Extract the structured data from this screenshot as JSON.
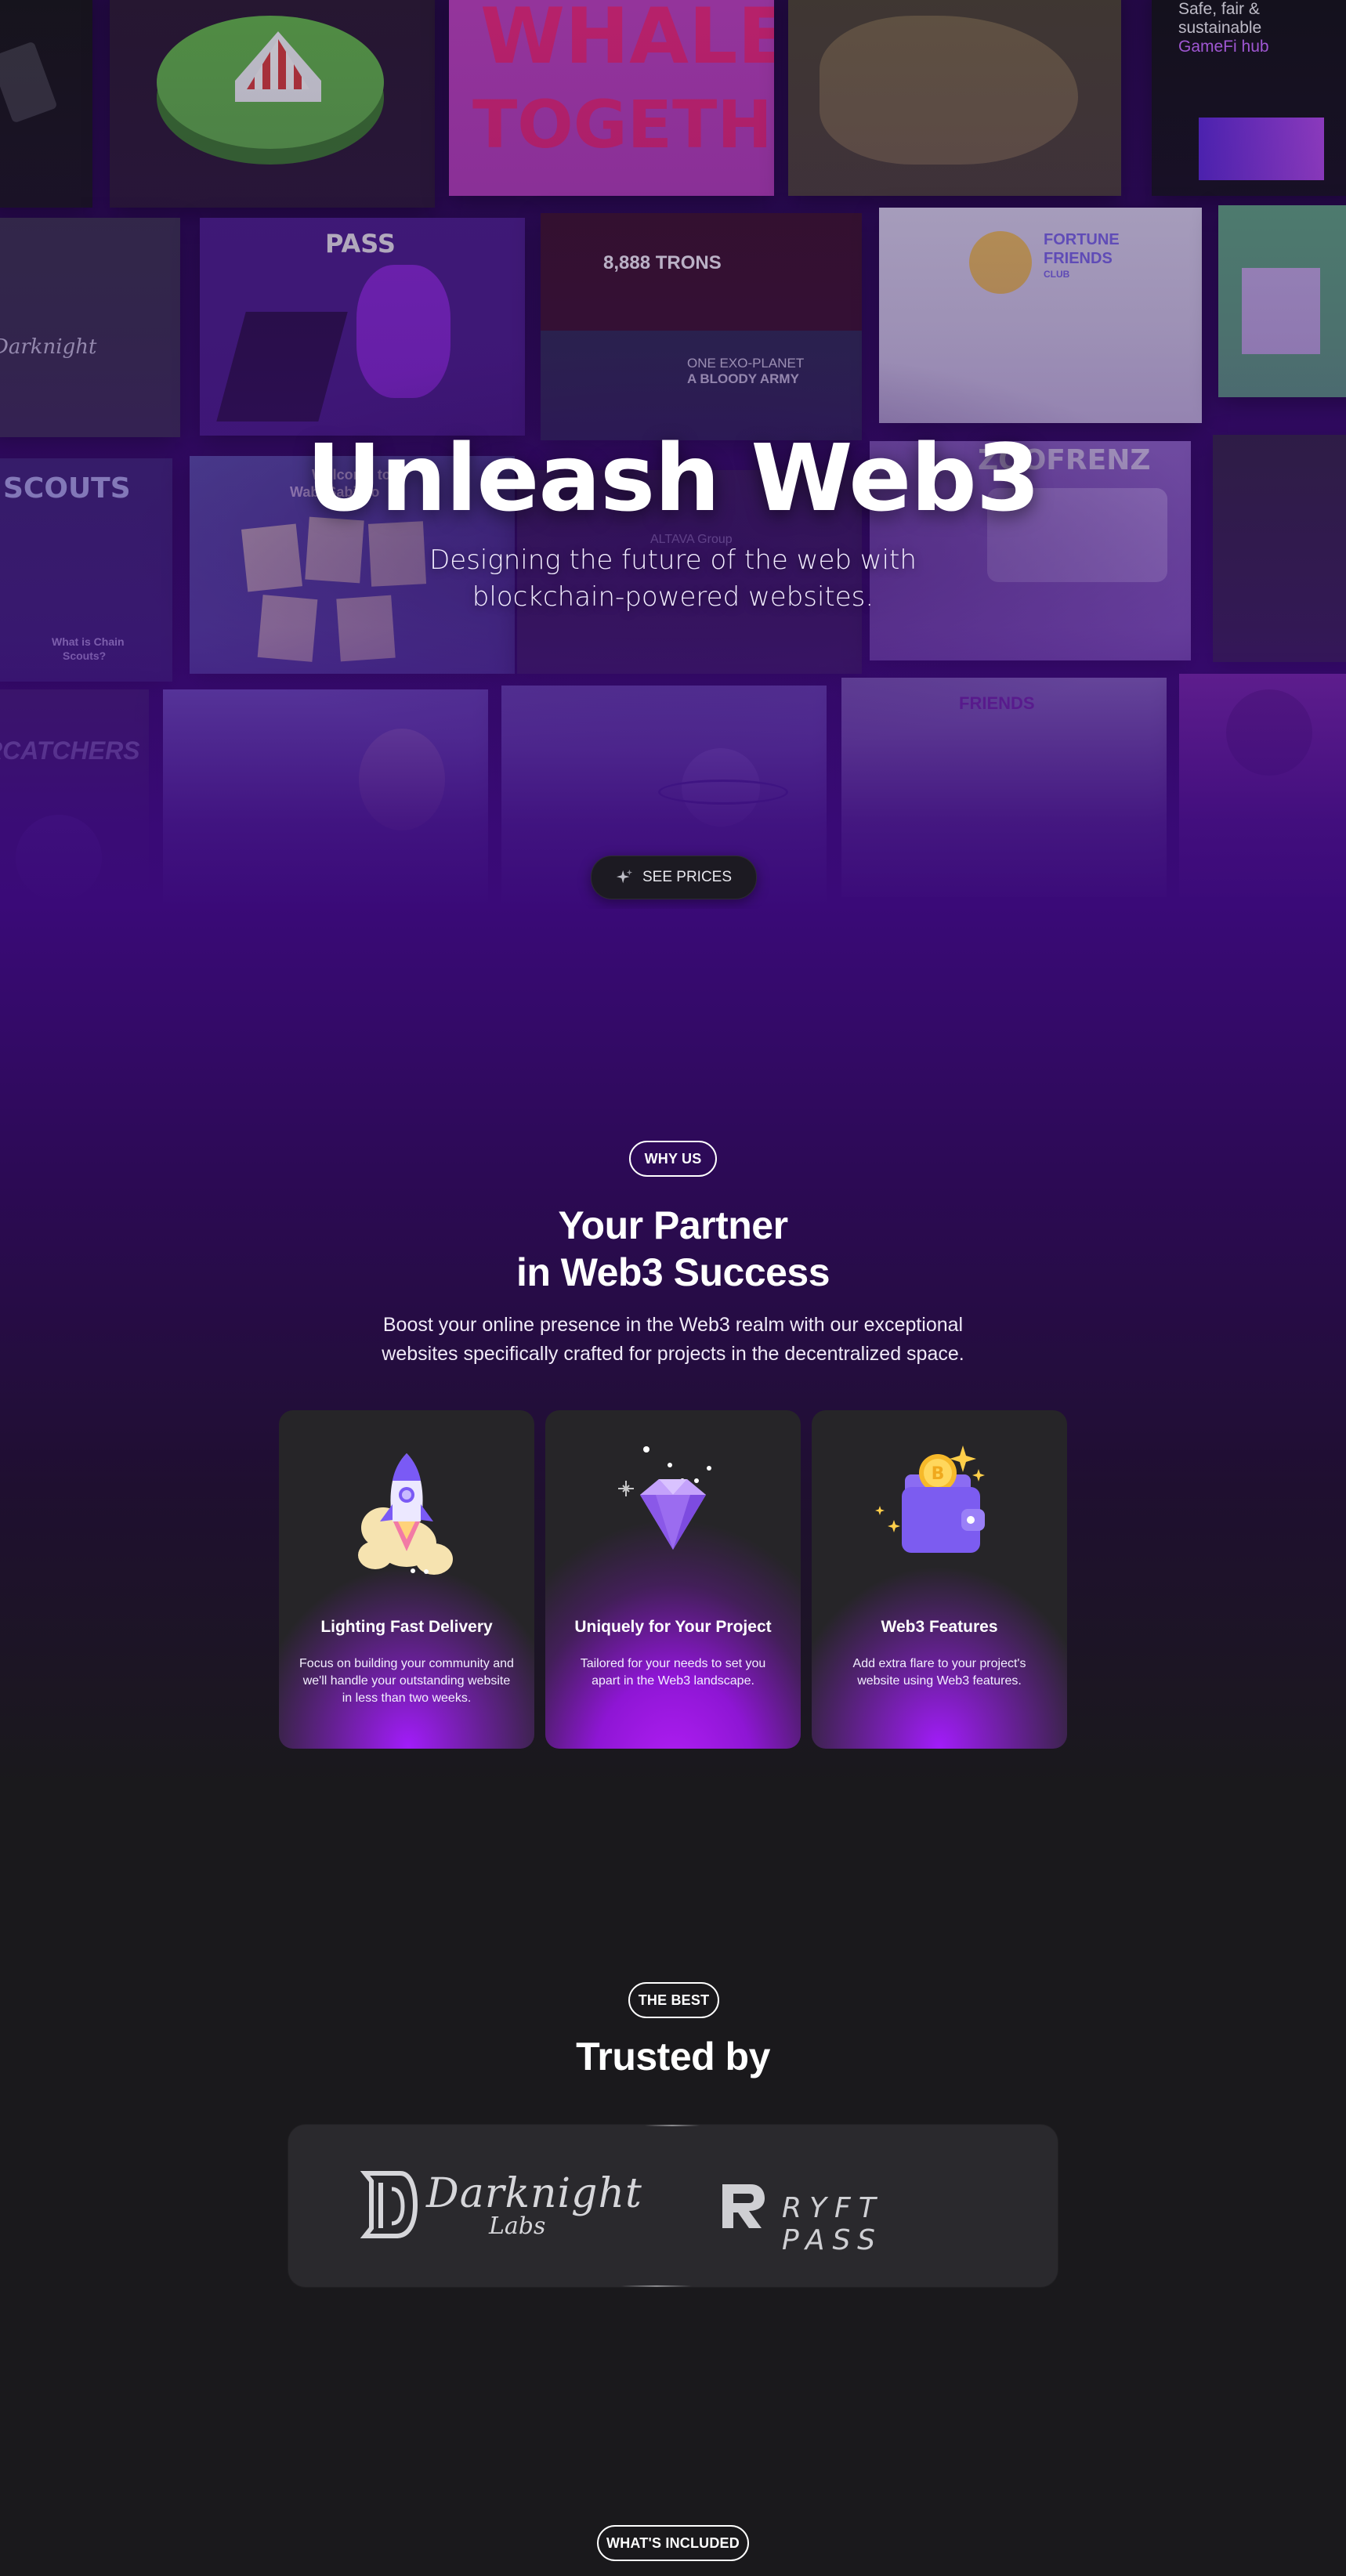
{
  "hero": {
    "title": "Unleash Web3",
    "subtitle": "Designing the future of the web with blockchain-powered websites.",
    "cta_label": "SEE PRICES",
    "tiles_text": {
      "whale": "WHALE",
      "together": "TOGETHER",
      "gamefi_1": "Safe, fair &",
      "gamefi_2": "sustainable",
      "gamefi_3": "GameFi hub",
      "pass": "PASS",
      "trons": "8,888 TRONS",
      "exo_1": "ONE EXO-PLANET",
      "exo_2": "A BLOODY ARMY",
      "fortune_1": "FORTUNE",
      "fortune_2": "FRIENDS",
      "fortune_3": "CLUB",
      "scouts": "SCOUTS",
      "chain_scouts_1": "What is Chain",
      "chain_scouts_2": "Scouts?",
      "wabi": "Welcome to",
      "wabi_2": "Wabi Sabi Co",
      "altava": "ALTAVA Group",
      "zoofrenz": "ZOOFRENZ",
      "catchers": "RCATCHERS",
      "friends": "FRIENDS",
      "darknight_small": "Darknight"
    }
  },
  "why_us": {
    "tag": "WHY US",
    "title_line1": "Your Partner",
    "title_line2": "in Web3 Success",
    "description": "Boost your online presence in the Web3 realm with our exceptional websites specifically crafted for projects in the decentralized space.",
    "cards": [
      {
        "title": "Lighting Fast Delivery",
        "text": "Focus on building your community and we'll handle your outstanding website in less than two weeks.",
        "icon": "rocket-icon"
      },
      {
        "title": "Uniquely for Your Project",
        "text": "Tailored for your needs to set you apart in the Web3 landscape.",
        "icon": "diamond-icon"
      },
      {
        "title": "Web3 Features",
        "text": "Add extra flare to your project's website using Web3 features.",
        "icon": "wallet-icon"
      }
    ]
  },
  "trusted": {
    "tag": "THE BEST",
    "title": "Trusted by",
    "logos": [
      {
        "name": "Darknight Labs",
        "line1": "Darknight",
        "line2": "Labs"
      },
      {
        "name": "RYFT PASS",
        "text": "RYFT PASS"
      }
    ]
  },
  "included": {
    "tag": "WHAT'S INCLUDED"
  },
  "colors": {
    "accent": "#a21cfa",
    "hero_purple": "#3a0a78",
    "page_dark": "#1a191c",
    "card_bg": "#262528"
  }
}
